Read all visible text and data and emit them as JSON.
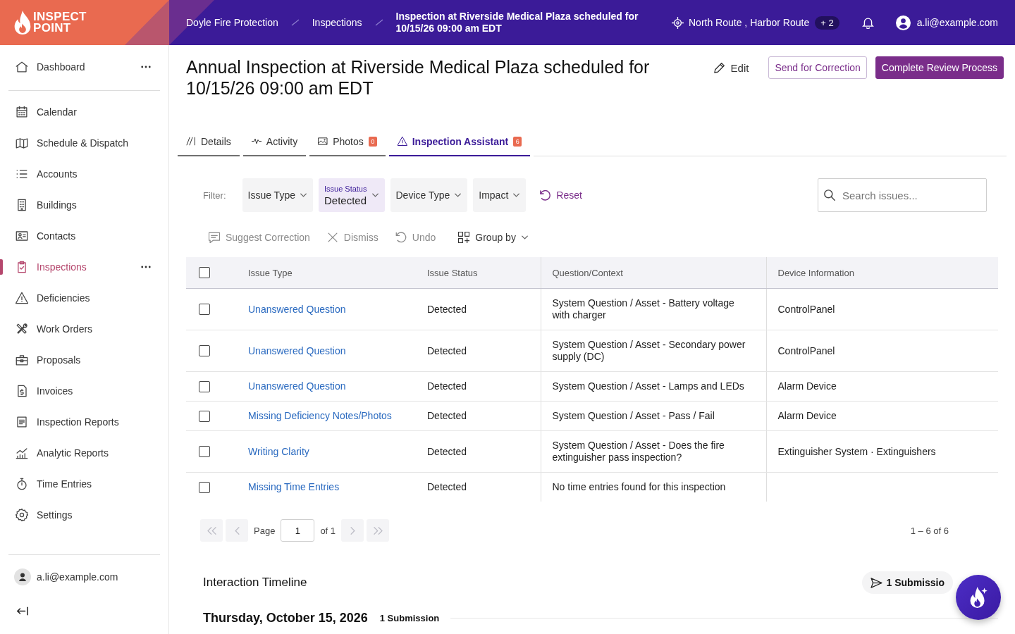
{
  "topbar": {
    "logo": [
      "INSPECT",
      "POINT"
    ],
    "breadcrumbs": [
      {
        "label": "Doyle Fire Protection",
        "current": false
      },
      {
        "label": "Inspections",
        "current": false
      },
      {
        "label": "Inspection at Riverside Medical Plaza scheduled for 10/15/26 09:00 am EDT",
        "current": true
      }
    ],
    "routes": {
      "label": "North Route , Harbor Route",
      "extra": "+ 2"
    },
    "user": "a.li@example.com"
  },
  "sidebar": {
    "sections": [
      {
        "items": [
          {
            "label": "Dashboard",
            "selected": false,
            "menu": true
          }
        ]
      },
      {
        "items": [
          {
            "label": "Calendar",
            "selected": false,
            "menu": false
          },
          {
            "label": "Schedule & Dispatch",
            "selected": false,
            "menu": false
          },
          {
            "label": "Accounts",
            "selected": false,
            "menu": false
          },
          {
            "label": "Buildings",
            "selected": false,
            "menu": false
          },
          {
            "label": "Contacts",
            "selected": false,
            "menu": false
          },
          {
            "label": "Inspections",
            "selected": true,
            "menu": true
          },
          {
            "label": "Deficiencies",
            "selected": false,
            "menu": false
          },
          {
            "label": "Work Orders",
            "selected": false,
            "menu": false
          },
          {
            "label": "Proposals",
            "selected": false,
            "menu": false
          },
          {
            "label": "Invoices",
            "selected": false,
            "menu": false
          },
          {
            "label": "Inspection Reports",
            "selected": false,
            "menu": false
          },
          {
            "label": "Analytic Reports",
            "selected": false,
            "menu": false
          },
          {
            "label": "Time Entries",
            "selected": false,
            "menu": false
          },
          {
            "label": "Settings",
            "selected": false,
            "menu": false
          }
        ]
      }
    ],
    "user": "a.li@example.com"
  },
  "header": {
    "title": "Annual Inspection at Riverside Medical Plaza scheduled for 10/15/26 09:00 am EDT",
    "actions": [
      {
        "label": "Edit",
        "kind": "text"
      },
      {
        "label": "Send for Correction",
        "kind": "outline"
      },
      {
        "label": "Complete Review Process",
        "kind": "primary"
      }
    ]
  },
  "tabs": [
    {
      "label": "Details",
      "selected": false
    },
    {
      "label": "Activity",
      "selected": false
    },
    {
      "label": "Photos",
      "badge": "0",
      "selected": false
    },
    {
      "label": "Inspection Assistant",
      "badge": "6",
      "selected": true
    }
  ],
  "filters": {
    "label": "Filter:",
    "dropdowns": [
      {
        "label": "Issue Type"
      },
      {
        "label": "Issue Status",
        "value": "Detected"
      },
      {
        "label": "Device Type"
      },
      {
        "label": "Impact"
      }
    ],
    "reset": "Reset",
    "search": {
      "placeholder": "Search issues..."
    }
  },
  "bulk_actions": [
    {
      "label": "Suggest Correction",
      "disabled": true,
      "dropdown": false
    },
    {
      "label": "Dismiss",
      "disabled": true,
      "dropdown": false
    },
    {
      "label": "Undo",
      "disabled": true,
      "dropdown": false
    },
    {
      "label": "Group by",
      "disabled": false,
      "dropdown": true
    }
  ],
  "table": {
    "all_checked": false,
    "columns": [
      "Issue Type",
      "Issue Status",
      "Question/Context",
      "Device Information"
    ],
    "rows": [
      {
        "checked": false,
        "issue_type": "Unanswered Question",
        "status": "Detected",
        "context": "System Question / Asset - Battery voltage with charger",
        "device": "ControlPanel"
      },
      {
        "checked": false,
        "issue_type": "Unanswered Question",
        "status": "Detected",
        "context": "System Question / Asset - Secondary power supply (DC)",
        "device": "ControlPanel"
      },
      {
        "checked": false,
        "issue_type": "Unanswered Question",
        "status": "Detected",
        "context": "System Question / Asset - Lamps and LEDs",
        "device": "Alarm Device"
      },
      {
        "checked": false,
        "issue_type": "Missing Deficiency Notes/Photos",
        "status": "Detected",
        "context": "System Question / Asset - Pass / Fail",
        "device": "Alarm Device"
      },
      {
        "checked": false,
        "issue_type": "Writing Clarity",
        "status": "Detected",
        "context": "System Question / Asset - Does the fire extinguisher pass inspection?",
        "device": "Extinguisher System · Extinguishers"
      },
      {
        "checked": false,
        "issue_type": "Missing Time Entries",
        "status": "Detected",
        "context": "No time entries found for this inspection"
      }
    ]
  },
  "pagination": {
    "label": "Page",
    "page": "1",
    "total": "of 1",
    "range": "1 – 6 of 6",
    "nav_disabled": true
  },
  "timeline": {
    "title": "Interaction Timeline",
    "submissions": "1 Submissio",
    "days": [
      {
        "date": "Thursday, October 15, 2026",
        "count": "1 Submission"
      }
    ]
  }
}
